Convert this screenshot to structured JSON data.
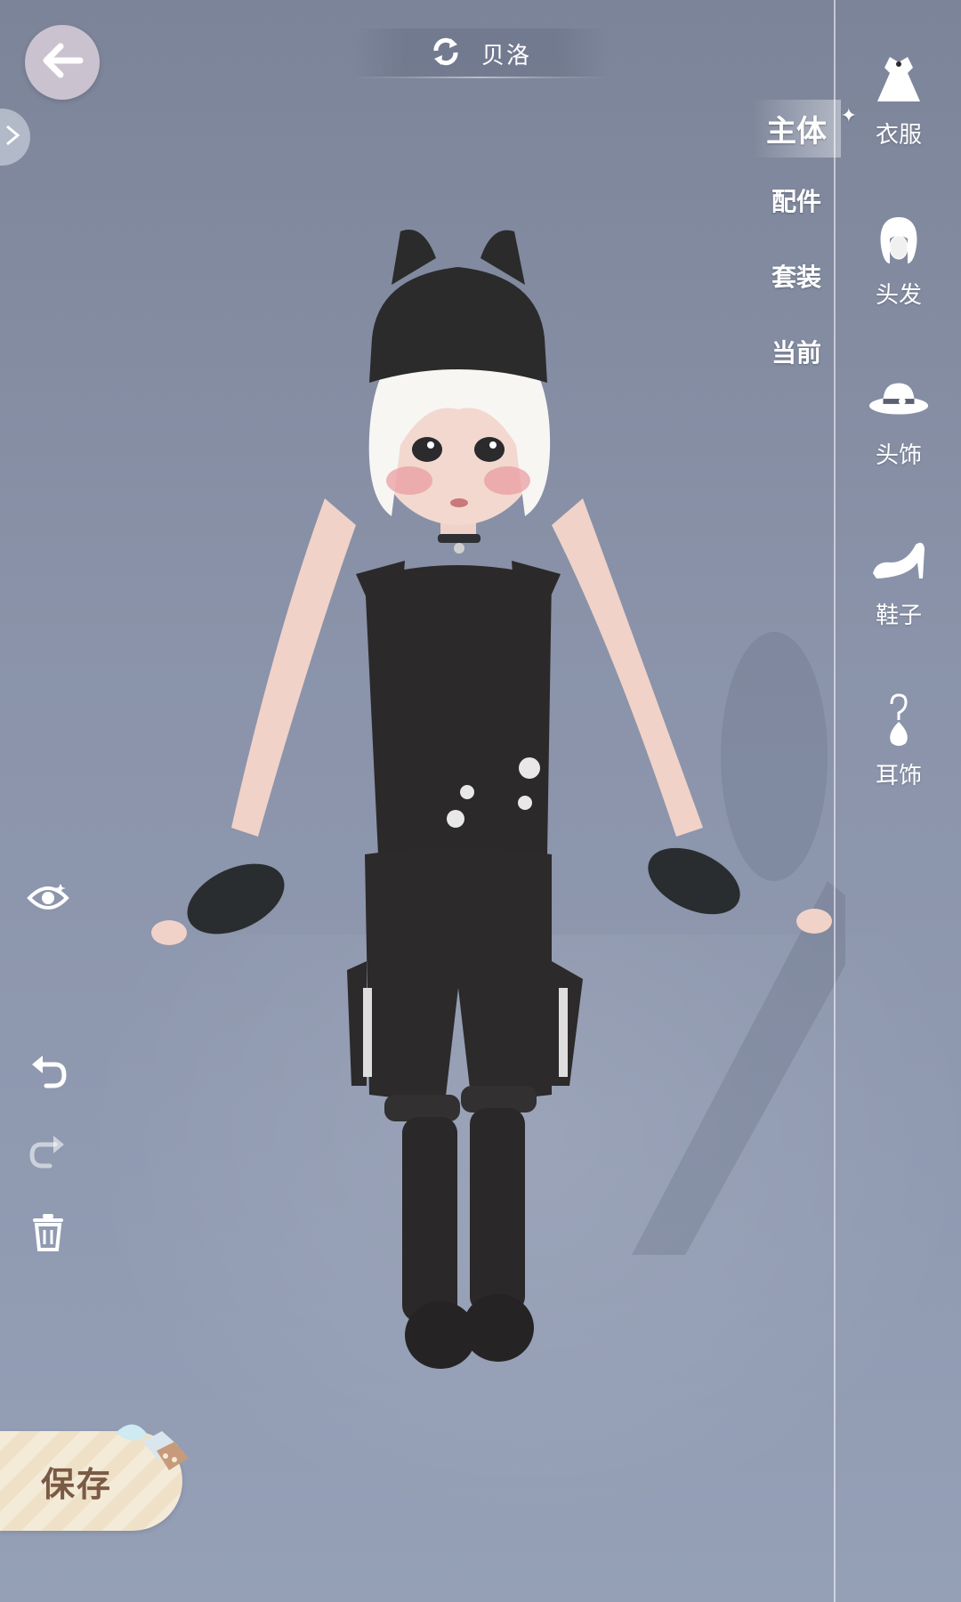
{
  "header": {
    "character_name": "贝洛"
  },
  "categories": [
    {
      "label": "主体",
      "active": true
    },
    {
      "label": "配件",
      "active": false
    },
    {
      "label": "套装",
      "active": false
    },
    {
      "label": "当前",
      "active": false
    }
  ],
  "slots": [
    {
      "label": "衣服",
      "icon": "dress-icon"
    },
    {
      "label": "头发",
      "icon": "hair-icon"
    },
    {
      "label": "头饰",
      "icon": "hat-icon"
    },
    {
      "label": "鞋子",
      "icon": "shoe-icon"
    },
    {
      "label": "耳饰",
      "icon": "earring-icon"
    }
  ],
  "actions": {
    "save_label": "保存"
  },
  "colors": {
    "background": "#8a93a9",
    "save_text": "#7a5a45"
  }
}
